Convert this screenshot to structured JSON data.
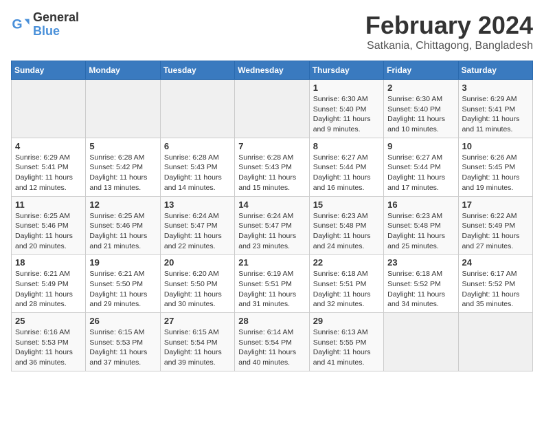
{
  "app": {
    "name": "GeneralBlue",
    "logo_line1": "General",
    "logo_line2": "Blue"
  },
  "header": {
    "month_year": "February 2024",
    "location": "Satkania, Chittagong, Bangladesh"
  },
  "days_of_week": [
    "Sunday",
    "Monday",
    "Tuesday",
    "Wednesday",
    "Thursday",
    "Friday",
    "Saturday"
  ],
  "weeks": [
    [
      {
        "day": "",
        "info": ""
      },
      {
        "day": "",
        "info": ""
      },
      {
        "day": "",
        "info": ""
      },
      {
        "day": "",
        "info": ""
      },
      {
        "day": "1",
        "info": "Sunrise: 6:30 AM\nSunset: 5:40 PM\nDaylight: 11 hours\nand 9 minutes."
      },
      {
        "day": "2",
        "info": "Sunrise: 6:30 AM\nSunset: 5:40 PM\nDaylight: 11 hours\nand 10 minutes."
      },
      {
        "day": "3",
        "info": "Sunrise: 6:29 AM\nSunset: 5:41 PM\nDaylight: 11 hours\nand 11 minutes."
      }
    ],
    [
      {
        "day": "4",
        "info": "Sunrise: 6:29 AM\nSunset: 5:41 PM\nDaylight: 11 hours\nand 12 minutes."
      },
      {
        "day": "5",
        "info": "Sunrise: 6:28 AM\nSunset: 5:42 PM\nDaylight: 11 hours\nand 13 minutes."
      },
      {
        "day": "6",
        "info": "Sunrise: 6:28 AM\nSunset: 5:43 PM\nDaylight: 11 hours\nand 14 minutes."
      },
      {
        "day": "7",
        "info": "Sunrise: 6:28 AM\nSunset: 5:43 PM\nDaylight: 11 hours\nand 15 minutes."
      },
      {
        "day": "8",
        "info": "Sunrise: 6:27 AM\nSunset: 5:44 PM\nDaylight: 11 hours\nand 16 minutes."
      },
      {
        "day": "9",
        "info": "Sunrise: 6:27 AM\nSunset: 5:44 PM\nDaylight: 11 hours\nand 17 minutes."
      },
      {
        "day": "10",
        "info": "Sunrise: 6:26 AM\nSunset: 5:45 PM\nDaylight: 11 hours\nand 19 minutes."
      }
    ],
    [
      {
        "day": "11",
        "info": "Sunrise: 6:25 AM\nSunset: 5:46 PM\nDaylight: 11 hours\nand 20 minutes."
      },
      {
        "day": "12",
        "info": "Sunrise: 6:25 AM\nSunset: 5:46 PM\nDaylight: 11 hours\nand 21 minutes."
      },
      {
        "day": "13",
        "info": "Sunrise: 6:24 AM\nSunset: 5:47 PM\nDaylight: 11 hours\nand 22 minutes."
      },
      {
        "day": "14",
        "info": "Sunrise: 6:24 AM\nSunset: 5:47 PM\nDaylight: 11 hours\nand 23 minutes."
      },
      {
        "day": "15",
        "info": "Sunrise: 6:23 AM\nSunset: 5:48 PM\nDaylight: 11 hours\nand 24 minutes."
      },
      {
        "day": "16",
        "info": "Sunrise: 6:23 AM\nSunset: 5:48 PM\nDaylight: 11 hours\nand 25 minutes."
      },
      {
        "day": "17",
        "info": "Sunrise: 6:22 AM\nSunset: 5:49 PM\nDaylight: 11 hours\nand 27 minutes."
      }
    ],
    [
      {
        "day": "18",
        "info": "Sunrise: 6:21 AM\nSunset: 5:49 PM\nDaylight: 11 hours\nand 28 minutes."
      },
      {
        "day": "19",
        "info": "Sunrise: 6:21 AM\nSunset: 5:50 PM\nDaylight: 11 hours\nand 29 minutes."
      },
      {
        "day": "20",
        "info": "Sunrise: 6:20 AM\nSunset: 5:50 PM\nDaylight: 11 hours\nand 30 minutes."
      },
      {
        "day": "21",
        "info": "Sunrise: 6:19 AM\nSunset: 5:51 PM\nDaylight: 11 hours\nand 31 minutes."
      },
      {
        "day": "22",
        "info": "Sunrise: 6:18 AM\nSunset: 5:51 PM\nDaylight: 11 hours\nand 32 minutes."
      },
      {
        "day": "23",
        "info": "Sunrise: 6:18 AM\nSunset: 5:52 PM\nDaylight: 11 hours\nand 34 minutes."
      },
      {
        "day": "24",
        "info": "Sunrise: 6:17 AM\nSunset: 5:52 PM\nDaylight: 11 hours\nand 35 minutes."
      }
    ],
    [
      {
        "day": "25",
        "info": "Sunrise: 6:16 AM\nSunset: 5:53 PM\nDaylight: 11 hours\nand 36 minutes."
      },
      {
        "day": "26",
        "info": "Sunrise: 6:15 AM\nSunset: 5:53 PM\nDaylight: 11 hours\nand 37 minutes."
      },
      {
        "day": "27",
        "info": "Sunrise: 6:15 AM\nSunset: 5:54 PM\nDaylight: 11 hours\nand 39 minutes."
      },
      {
        "day": "28",
        "info": "Sunrise: 6:14 AM\nSunset: 5:54 PM\nDaylight: 11 hours\nand 40 minutes."
      },
      {
        "day": "29",
        "info": "Sunrise: 6:13 AM\nSunset: 5:55 PM\nDaylight: 11 hours\nand 41 minutes."
      },
      {
        "day": "",
        "info": ""
      },
      {
        "day": "",
        "info": ""
      }
    ]
  ]
}
